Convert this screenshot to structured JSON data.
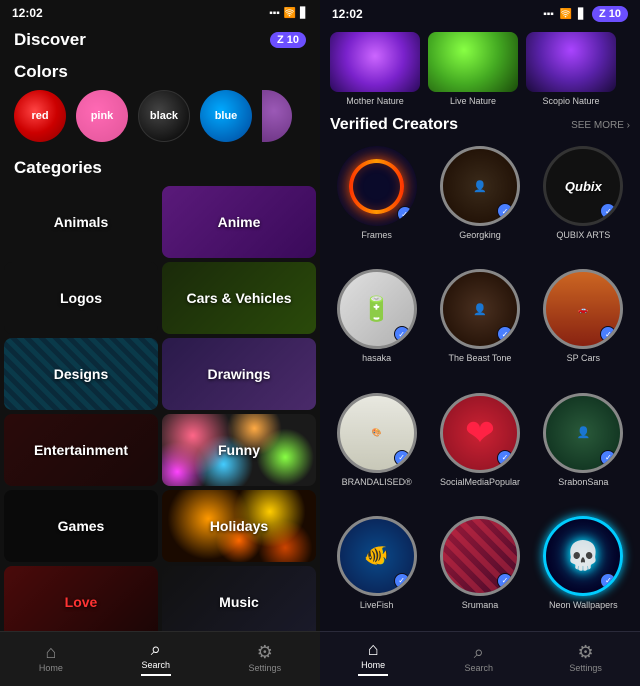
{
  "left": {
    "status": {
      "time": "12:02",
      "battery": "🔋",
      "signal": "📶"
    },
    "header": {
      "title": "Discover",
      "badge": "Z 10"
    },
    "colors": {
      "section_title": "Colors",
      "items": [
        {
          "label": "red",
          "class": "color-red"
        },
        {
          "label": "pink",
          "class": "color-pink"
        },
        {
          "label": "black",
          "class": "color-black"
        },
        {
          "label": "blue",
          "class": "color-blue"
        }
      ]
    },
    "categories": {
      "section_title": "Categories",
      "items": [
        {
          "label": "Animals",
          "class": "bg-animals"
        },
        {
          "label": "Anime",
          "class": "bg-anime"
        },
        {
          "label": "Logos",
          "class": "bg-logos"
        },
        {
          "label": "Cars & Vehicles",
          "class": "bg-cars"
        },
        {
          "label": "Designs",
          "class": "stripe-design"
        },
        {
          "label": "Drawings",
          "class": "bg-drawings"
        },
        {
          "label": "Entertainment",
          "class": "bg-entertainment"
        },
        {
          "label": "Funny",
          "class": "colorful-dots"
        },
        {
          "label": "Games",
          "class": "bg-games"
        },
        {
          "label": "Holidays",
          "class": "bokeh-holidays"
        },
        {
          "label": "Love",
          "class": "bg-love"
        },
        {
          "label": "Music",
          "class": "bg-music"
        }
      ]
    },
    "nav": {
      "items": [
        {
          "label": "Home",
          "icon": "⌂",
          "active": false
        },
        {
          "label": "Search",
          "icon": "⌕",
          "active": true
        },
        {
          "label": "Settings",
          "icon": "⚙",
          "active": false
        }
      ]
    }
  },
  "right": {
    "status": {
      "time": "12:02",
      "badge": "Z 10"
    },
    "nature_items": [
      {
        "label": "Mother Nature",
        "class": "mother-art"
      },
      {
        "label": "Live Nature",
        "class": "live-nature-art"
      },
      {
        "label": "Scopio Nature",
        "class": "scopio-art"
      }
    ],
    "verified": {
      "title": "Verified Creators",
      "see_more": "SEE MORE ›"
    },
    "creators": [
      {
        "name": "Frames",
        "avatar_class": "frames"
      },
      {
        "name": "Georgking",
        "avatar_class": "georgking-art"
      },
      {
        "name": "QUBIX ARTS",
        "avatar_class": "qubix"
      },
      {
        "name": "hasaka",
        "avatar_class": "hasaka"
      },
      {
        "name": "The Beast Tone",
        "avatar_class": "beast"
      },
      {
        "name": "SP Cars",
        "avatar_class": "sp-cars"
      },
      {
        "name": "BRANDALISED®",
        "avatar_class": "brand"
      },
      {
        "name": "SocialMediaPopular",
        "avatar_class": "social"
      },
      {
        "name": "SrabonSana",
        "avatar_class": "sarabon"
      },
      {
        "name": "LiveFish",
        "avatar_class": "fish"
      },
      {
        "name": "Srumana",
        "avatar_class": "srumana"
      },
      {
        "name": "Neon Wallpapers",
        "avatar_class": "neon"
      }
    ],
    "nav": {
      "items": [
        {
          "label": "Home",
          "icon": "⌂",
          "active": true
        },
        {
          "label": "Search",
          "icon": "⌕",
          "active": false
        },
        {
          "label": "Settings",
          "icon": "⚙",
          "active": false
        }
      ]
    }
  }
}
